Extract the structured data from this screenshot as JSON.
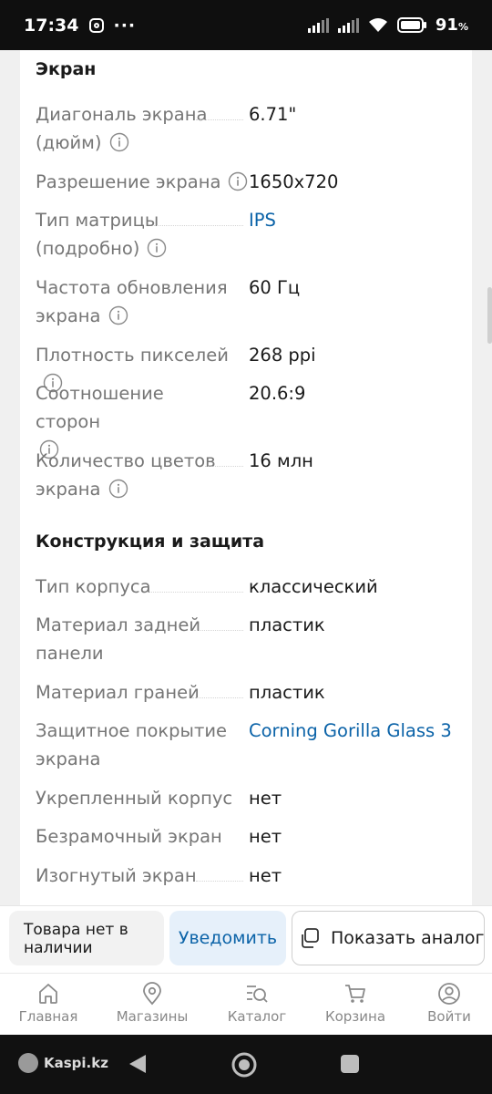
{
  "status_bar": {
    "time": "17:34",
    "more": "···",
    "battery_percent": "91",
    "battery_unit": "%"
  },
  "sections": [
    {
      "title": "Экран",
      "rows": [
        {
          "label": "Диагональ экрана (дюйм)",
          "value": "6.71\"",
          "info": true,
          "link": false
        },
        {
          "label": "Разрешение экрана",
          "value": "1650x720",
          "info": true,
          "link": false
        },
        {
          "label": "Тип матрицы (подробно)",
          "value": "IPS",
          "info": true,
          "link": true
        },
        {
          "label": "Частота обновления экрана",
          "value": "60 Гц",
          "info": true,
          "link": false
        },
        {
          "label": "Плотность пикселей",
          "value": "268 ppi",
          "info": true,
          "link": false
        },
        {
          "label": "Соотношение сторон",
          "value": "20.6:9",
          "info": true,
          "link": false
        },
        {
          "label": "Количество цветов экрана",
          "value": "16 млн",
          "info": true,
          "link": false
        }
      ]
    },
    {
      "title": "Конструкция и защита",
      "rows": [
        {
          "label": "Тип корпуса",
          "value": "классический",
          "info": false,
          "link": false
        },
        {
          "label": "Материал задней панели",
          "value": "пластик",
          "info": false,
          "link": false
        },
        {
          "label": "Материал граней",
          "value": "пластик",
          "info": false,
          "link": false
        },
        {
          "label": "Защитное покрытие экрана",
          "value": "Corning Gorilla Glass 3",
          "info": false,
          "link": true
        },
        {
          "label": "Укрепленный корпус",
          "value": "нет",
          "info": false,
          "link": false
        },
        {
          "label": "Безрамочный экран",
          "value": "нет",
          "info": false,
          "link": false
        },
        {
          "label": "Изогнутый экран",
          "value": "нет",
          "info": false,
          "link": false
        }
      ]
    }
  ],
  "action_bar": {
    "out_of_stock": "Товара нет в наличии",
    "notify": "Уведомить",
    "show_analogs": "Показать аналоги"
  },
  "tabs": [
    {
      "label": "Главная",
      "icon": "home-icon"
    },
    {
      "label": "Магазины",
      "icon": "location-pin-icon"
    },
    {
      "label": "Каталог",
      "icon": "catalog-search-icon"
    },
    {
      "label": "Корзина",
      "icon": "cart-icon"
    },
    {
      "label": "Войти",
      "icon": "user-icon"
    }
  ],
  "nav_bar": {
    "brand": "Kaspi.kz"
  },
  "colors": {
    "link": "#0b63a8",
    "label": "#767676",
    "notify_bg": "#e6f0fa"
  }
}
